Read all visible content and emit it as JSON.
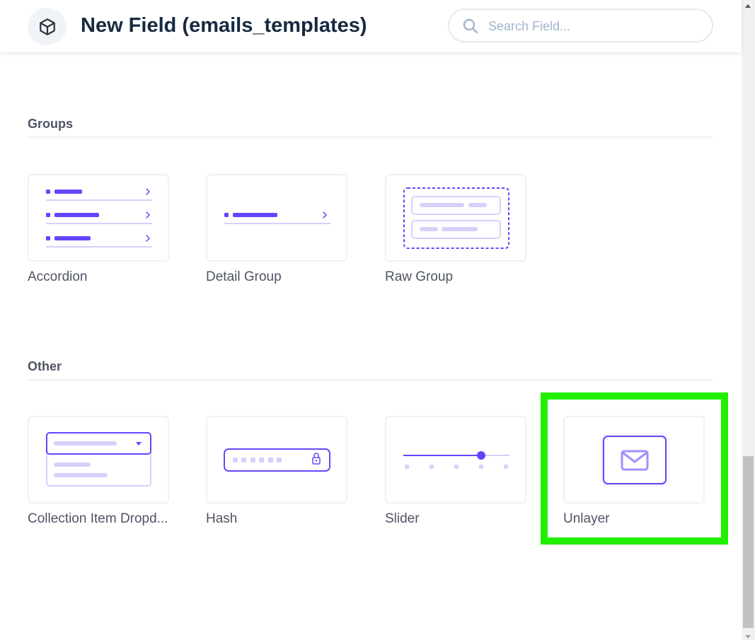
{
  "header": {
    "title": "New Field (emails_templates)",
    "icon": "cube-icon",
    "search": {
      "placeholder": "Search Field...",
      "value": ""
    }
  },
  "sections": [
    {
      "title": "Groups",
      "items": [
        {
          "label": "Accordion",
          "icon": "accordion-preview"
        },
        {
          "label": "Detail Group",
          "icon": "detail-group-preview"
        },
        {
          "label": "Raw Group",
          "icon": "raw-group-preview"
        }
      ]
    },
    {
      "title": "Other",
      "items": [
        {
          "label": "Collection Item Dropd...",
          "icon": "dropdown-preview"
        },
        {
          "label": "Hash",
          "icon": "hash-preview"
        },
        {
          "label": "Slider",
          "icon": "slider-preview"
        },
        {
          "label": "Unlayer",
          "icon": "mail-preview"
        }
      ]
    }
  ],
  "colors": {
    "accent": "#6644ff",
    "accent_light": "#d6d0fb",
    "highlight": "#22ee00",
    "title": "#172940",
    "text": "#4f5464"
  }
}
